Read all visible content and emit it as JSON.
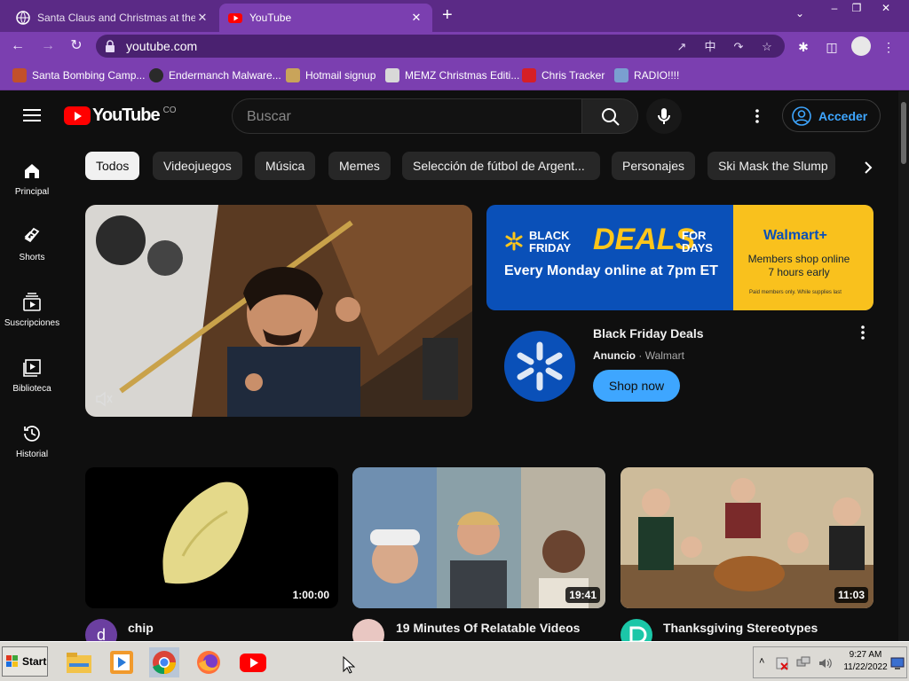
{
  "browser": {
    "tabs": [
      {
        "title": "Santa Claus and Christmas at the N",
        "active": false,
        "favicon": "globe-icon"
      },
      {
        "title": "YouTube",
        "active": true,
        "favicon": "youtube-icon"
      }
    ],
    "new_tab": "+",
    "close": "✕",
    "url": "youtube.com",
    "theme_color": "#7b3fb0"
  },
  "bookmarks": [
    {
      "label": "Santa Bombing Camp..."
    },
    {
      "label": "Endermanch Malware..."
    },
    {
      "label": "Hotmail signup"
    },
    {
      "label": "MEMZ Christmas Editi..."
    },
    {
      "label": "Chris Tracker"
    },
    {
      "label": "RADIO!!!!"
    }
  ],
  "youtube": {
    "logo_text": "YouTube",
    "logo_region": "CO",
    "search_placeholder": "Buscar",
    "signin_label": "Acceder",
    "sidebar": [
      {
        "label": "Principal",
        "icon": "home-icon"
      },
      {
        "label": "Shorts",
        "icon": "shorts-icon"
      },
      {
        "label": "Suscripciones",
        "icon": "subscriptions-icon"
      },
      {
        "label": "Biblioteca",
        "icon": "library-icon"
      },
      {
        "label": "Historial",
        "icon": "history-icon"
      }
    ],
    "chips": [
      "Todos",
      "Videojuegos",
      "Música",
      "Memes",
      "Selección de fútbol de Argent...",
      "Personajes",
      "Ski Mask the Slump"
    ],
    "selected_chip": "Todos",
    "ad": {
      "banner_bf": "BLACK FRIDAY",
      "banner_deals": "DEALS",
      "banner_for_days": "FOR DAYS",
      "banner_sub": "Every Monday online at 7pm ET",
      "banner_brand": "Walmart+",
      "banner_members": "Members shop online 7 hours early",
      "banner_fine": "Paid members only. While supplies last",
      "title": "Black Friday Deals",
      "label": "Anuncio",
      "separator": "·",
      "advertiser": "Walmart",
      "cta": "Shop now"
    },
    "videos": [
      {
        "title": "chip",
        "duration": "1:00:00",
        "channel_initial": "d"
      },
      {
        "title": "19 Minutes Of Relatable Videos",
        "duration": "19:41"
      },
      {
        "title": "Thanksgiving Stereotypes",
        "duration": "11:03"
      }
    ]
  },
  "taskbar": {
    "start_label": "Start",
    "time": "9:27 AM",
    "date": "11/22/2022"
  }
}
